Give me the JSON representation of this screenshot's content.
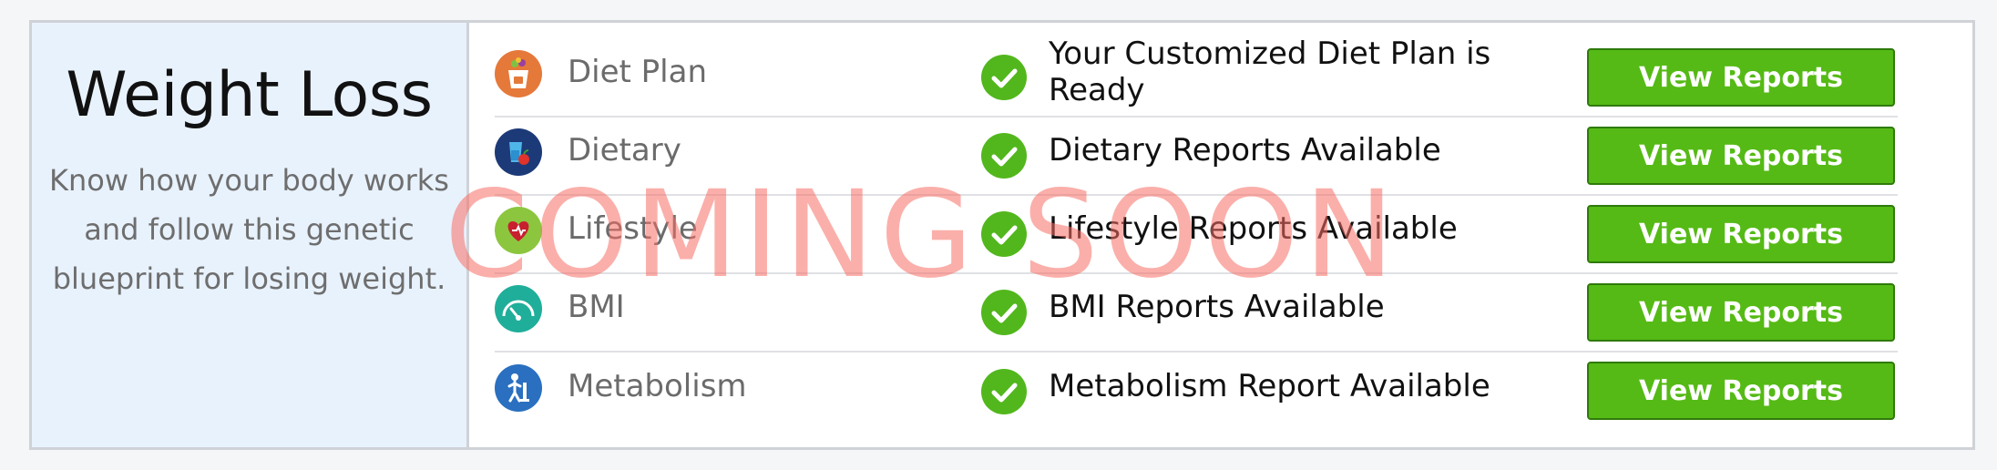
{
  "panel": {
    "title": "Weight Loss",
    "description": "Know how your body works and follow this genetic blueprint for losing weight."
  },
  "rows": [
    {
      "label": "Diet Plan",
      "status": "Your Customized Diet Plan is Ready",
      "button": "View Reports",
      "icon": "diet-plan-icon"
    },
    {
      "label": "Dietary",
      "status": "Dietary Reports Available",
      "button": "View Reports",
      "icon": "dietary-icon"
    },
    {
      "label": "Lifestyle",
      "status": "Lifestyle Reports Available",
      "button": "View Reports",
      "icon": "lifestyle-heart-icon"
    },
    {
      "label": "BMI",
      "status": "BMI Reports Available",
      "button": "View Reports",
      "icon": "bmi-gauge-icon"
    },
    {
      "label": "Metabolism",
      "status": "Metabolism Report Available",
      "button": "View Reports",
      "icon": "metabolism-icon"
    }
  ],
  "watermark": "COMING SOON",
  "colors": {
    "button": "#55ba15",
    "check": "#52b71c",
    "panel_bg": "#e8f2fd",
    "watermark": "#f86e64"
  }
}
